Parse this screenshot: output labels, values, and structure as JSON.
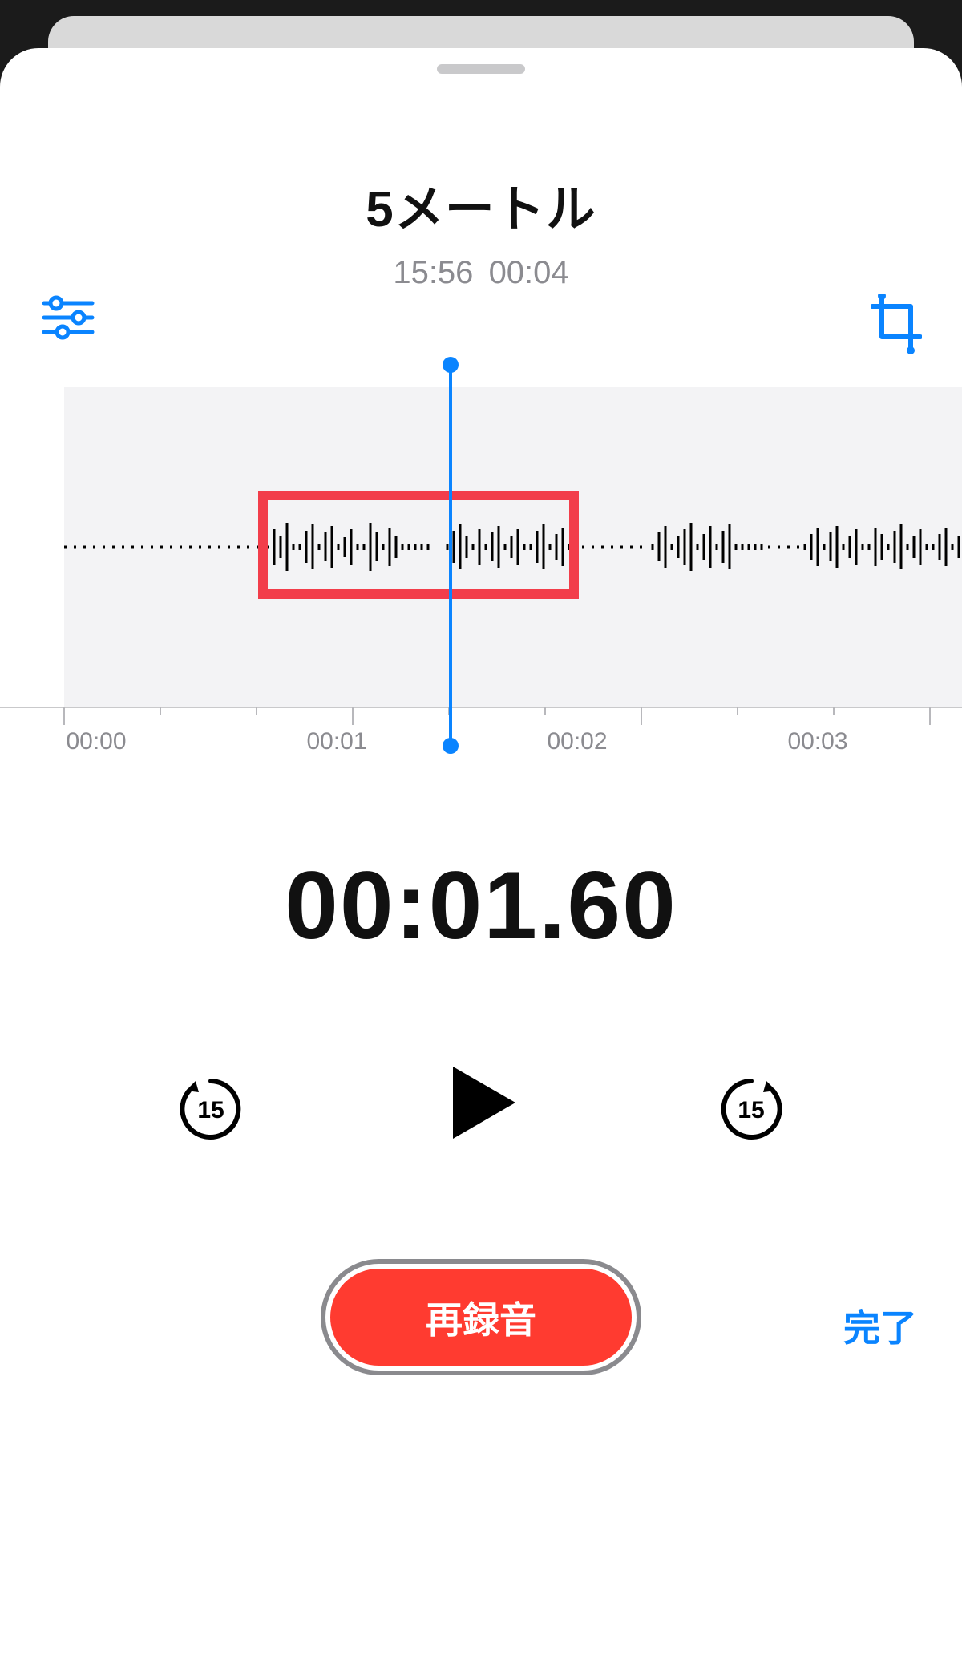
{
  "title": "5メートル",
  "meta_time": "15:56",
  "meta_duration": "00:04",
  "current_time": "00:01.60",
  "ruler_labels": [
    "00:00",
    "00:01",
    "00:02",
    "00:03"
  ],
  "controls": {
    "skip_seconds": "15",
    "skip_seconds_fwd": "15",
    "play_label": "play",
    "skip_back_label": "skip-back-15",
    "skip_forward_label": "skip-forward-15"
  },
  "buttons": {
    "rerecord": "再録音",
    "done": "完了"
  },
  "toolbar": {
    "filters_label": "filters",
    "crop_label": "crop"
  },
  "colors": {
    "accent": "#0a84ff",
    "record": "#ff3b30",
    "highlight": "#f23d4a"
  }
}
